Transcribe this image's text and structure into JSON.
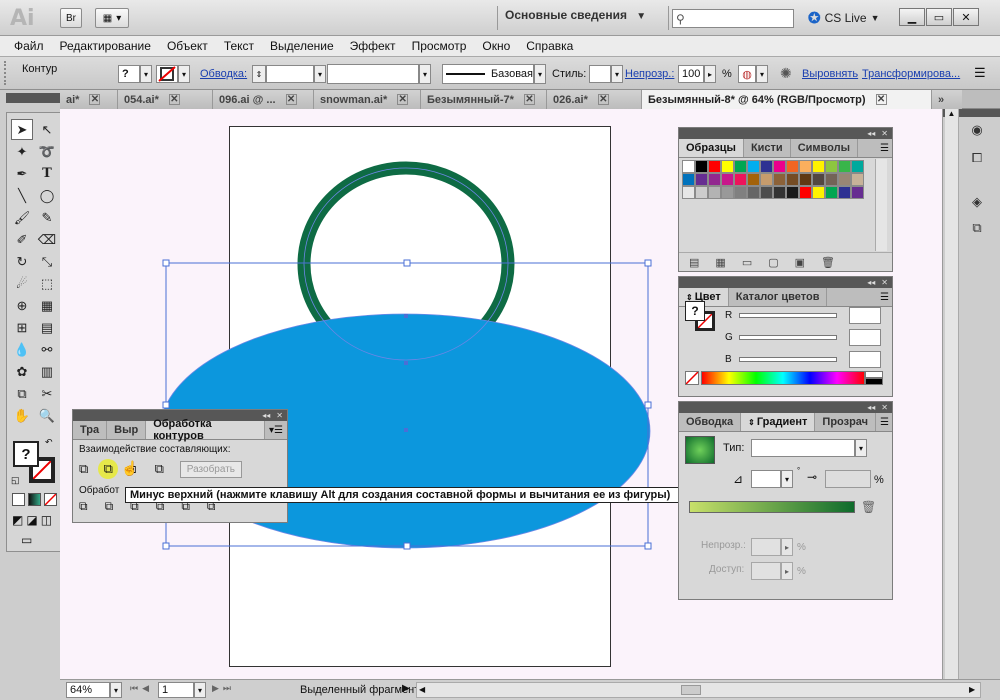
{
  "titlebar": {
    "app_logo": "Ai",
    "bridge_label": "Br",
    "workspace": "Основные сведения",
    "search_placeholder": "",
    "cs_live": "CS Live",
    "icons": [
      "layout-icon",
      "search-icon",
      "cs-live-icon",
      "minimize-icon",
      "maximize-icon",
      "close-icon"
    ]
  },
  "menu": [
    "Файл",
    "Редактирование",
    "Объект",
    "Текст",
    "Выделение",
    "Эффект",
    "Просмотр",
    "Окно",
    "Справка"
  ],
  "control": {
    "label": "Контур",
    "stroke_link": "Обводка:",
    "stroke_style": "Базовая",
    "style_label": "Стиль:",
    "opacity_link": "Непрозр.:",
    "opacity_value": "100",
    "percent": "%",
    "align_link": "Выровнять",
    "transform_link": "Трансформирова..."
  },
  "tabs": [
    {
      "name": "ai*",
      "active": false
    },
    {
      "name": "054.ai*",
      "active": false
    },
    {
      "name": "096.ai @ ...",
      "active": false
    },
    {
      "name": "snowman.ai*",
      "active": false
    },
    {
      "name": "Безымянный-7*",
      "active": false
    },
    {
      "name": "026.ai*",
      "active": false
    },
    {
      "name": "Безымянный-8* @ 64% (RGB/Просмотр)",
      "active": true
    }
  ],
  "canvas": {
    "ellipse_color": "#0c97dd",
    "arc_color": "#0e6b44",
    "bbox_color": "#4a6fd6"
  },
  "swatches_panel": {
    "tabs": [
      "Образцы",
      "Кисти",
      "Символы"
    ],
    "active": "Образцы"
  },
  "color_panel": {
    "tabs": [
      "Цвет",
      "Каталог цветов"
    ],
    "channels": [
      "R",
      "G",
      "B"
    ]
  },
  "gradient_panel": {
    "tabs": [
      "Обводка",
      "Градиент",
      "Прозрач"
    ],
    "type_label": "Тип:",
    "percent": "%",
    "opacity_label": "Непрозр.:",
    "location_label": "Доступ:",
    "gradient_start": "#c8e06a",
    "gradient_end": "#0e6b2c"
  },
  "pathfinder": {
    "tabs": [
      "Тра",
      "Выр",
      "Обработка контуров"
    ],
    "shape_modes_label": "Взаимодействие составляющих:",
    "expand_button": "Разобрать",
    "pathfinders_label": "Обработ"
  },
  "tooltip": "Минус верхний (нажмите клавишу Alt для создания составной формы и вычитания ее из фигуры)",
  "status": {
    "zoom": "64%",
    "page": "1",
    "status_text": "Выделенный фрагмент"
  }
}
